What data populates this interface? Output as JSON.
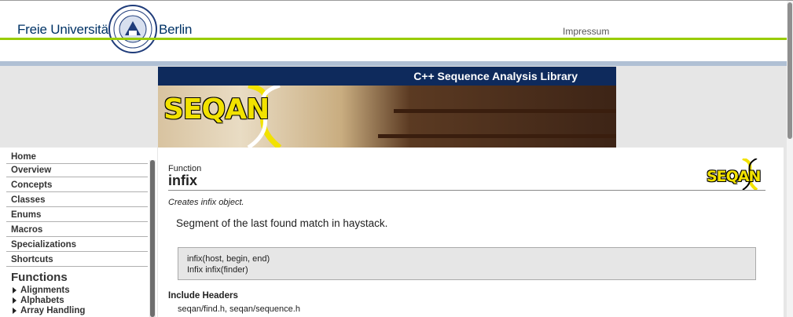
{
  "header": {
    "brand_left": "Freie Universität",
    "brand_right": "Berlin",
    "impressum_link": "Impressum"
  },
  "banner": {
    "title": "C++ Sequence Analysis Library",
    "logo_text": "SEQAN"
  },
  "sidebar": {
    "items": [
      {
        "label": "Home"
      },
      {
        "label": "Overview"
      },
      {
        "label": "Concepts"
      },
      {
        "label": "Classes"
      },
      {
        "label": "Enums"
      },
      {
        "label": "Macros"
      },
      {
        "label": "Specializations"
      },
      {
        "label": "Shortcuts"
      }
    ],
    "functions_heading": "Functions",
    "function_groups": [
      {
        "label": "Alignments"
      },
      {
        "label": "Alphabets"
      },
      {
        "label": "Array Handling"
      }
    ]
  },
  "content": {
    "kind": "Function",
    "title": "infix",
    "summary": "Creates infix object.",
    "description": "Segment of the last found match in haystack.",
    "signatures": [
      "infix(host, begin, end)",
      "Infix infix(finder)"
    ],
    "include_label": "Include Headers",
    "include_value": "seqan/find.h, seqan/sequence.h",
    "corner_logo_text": "SEQAN"
  },
  "colors": {
    "accent_green": "#99cc00",
    "banner_navy": "#0e2a5c",
    "logo_yellow": "#f2e200",
    "brand_blue": "#003366"
  }
}
